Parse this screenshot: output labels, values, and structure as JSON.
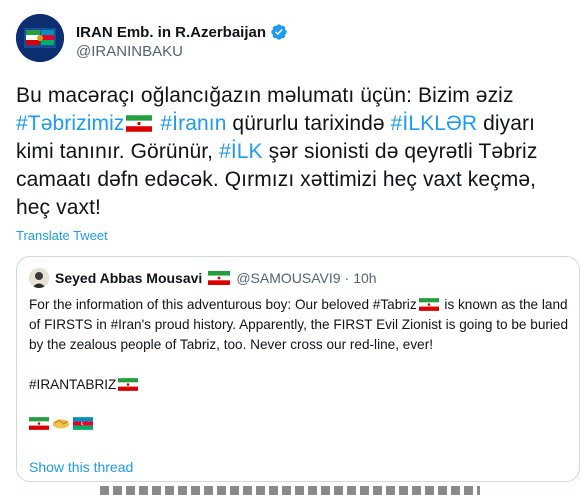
{
  "account": {
    "display_name": "IRAN Emb. in R.Azerbaijan",
    "handle": "@IRANINBAKU",
    "verified_icon": "verified-badge-icon",
    "avatar_icon": "embassy-logo-avatar"
  },
  "tweet": {
    "segments": [
      {
        "text": "Bu macəraçı oğlancığazın məlumatı üçün: Bizim əziz ",
        "type": "text"
      },
      {
        "text": "#Təbrizimiz",
        "type": "hashtag"
      },
      {
        "text": "",
        "type": "flag-iran"
      },
      {
        "text": " ",
        "type": "text"
      },
      {
        "text": "#İranın",
        "type": "hashtag"
      },
      {
        "text": " qürurlu tarixində ",
        "type": "text"
      },
      {
        "text": "#İLKLƏR",
        "type": "hashtag"
      },
      {
        "text": " diyarı kimi tanınır. Görünür, ",
        "type": "text"
      },
      {
        "text": "#İLK",
        "type": "hashtag"
      },
      {
        "text": " şər sionisti də qeyrətli Təbriz camaatı dəfn edəcək. Qırmızı xəttimizi heç vaxt keçmə, heç vaxt!",
        "type": "text"
      }
    ],
    "translate_label": "Translate Tweet"
  },
  "quote": {
    "author_name": "Seyed Abbas Mousavi",
    "author_handle": "@SAMOUSAVI9",
    "separator": "·",
    "time": "10h",
    "text_part1": "For the information of this adventurous boy: Our beloved #Tabriz",
    "text_part2": " is known as the land of FIRSTS in #Iran's proud history.  Apparently, the FIRST Evil Zionist is going to be buried by the zealous people of Tabriz, too. Never cross our red-line, ever!",
    "hashtag_line": "#IRANTABRIZ",
    "emoji_line": [
      "flag-iran-icon",
      "handshake-icon",
      "flag-azerbaijan-icon"
    ],
    "show_thread_label": "Show this thread"
  },
  "colors": {
    "accent": "#1d9bf0",
    "text": "#0f1419",
    "secondary": "#536471",
    "border": "#cfd9de"
  }
}
